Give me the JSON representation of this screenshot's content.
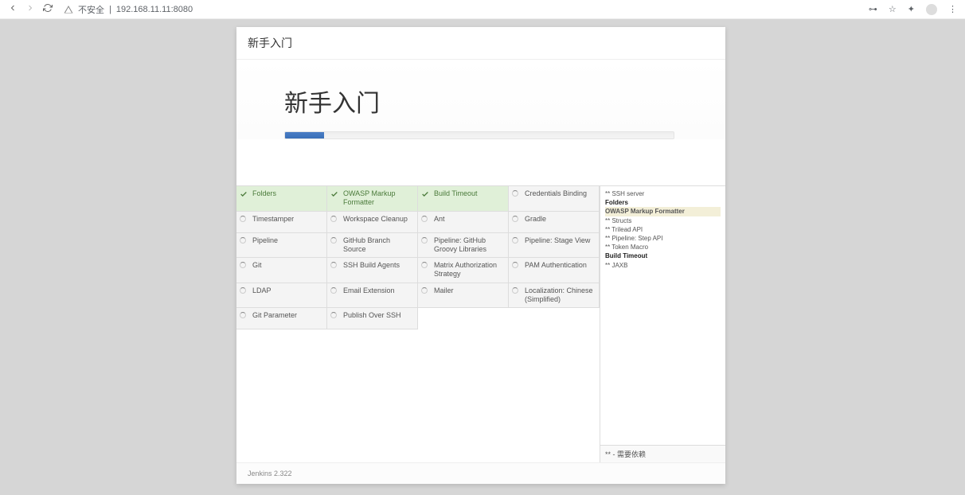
{
  "browser": {
    "insecure_label": "不安全",
    "url": "192.168.11.11:8080"
  },
  "dialog": {
    "header": "新手入门",
    "title": "新手入门",
    "progress_percent": 10,
    "footer_version": "Jenkins 2.322"
  },
  "plugins": [
    {
      "name": "Folders",
      "status": "done"
    },
    {
      "name": "OWASP Markup Formatter",
      "status": "done"
    },
    {
      "name": "Build Timeout",
      "status": "done"
    },
    {
      "name": "Credentials Binding",
      "status": "pending"
    },
    {
      "name": "Timestamper",
      "status": "pending"
    },
    {
      "name": "Workspace Cleanup",
      "status": "pending"
    },
    {
      "name": "Ant",
      "status": "pending"
    },
    {
      "name": "Gradle",
      "status": "pending"
    },
    {
      "name": "Pipeline",
      "status": "pending"
    },
    {
      "name": "GitHub Branch Source",
      "status": "pending"
    },
    {
      "name": "Pipeline: GitHub Groovy Libraries",
      "status": "pending"
    },
    {
      "name": "Pipeline: Stage View",
      "status": "pending"
    },
    {
      "name": "Git",
      "status": "pending"
    },
    {
      "name": "SSH Build Agents",
      "status": "pending"
    },
    {
      "name": "Matrix Authorization Strategy",
      "status": "pending"
    },
    {
      "name": "PAM Authentication",
      "status": "pending"
    },
    {
      "name": "LDAP",
      "status": "pending"
    },
    {
      "name": "Email Extension",
      "status": "pending"
    },
    {
      "name": "Mailer",
      "status": "pending"
    },
    {
      "name": "Localization: Chinese (Simplified)",
      "status": "pending"
    },
    {
      "name": "Git Parameter",
      "status": "pending"
    },
    {
      "name": "Publish Over SSH",
      "status": "pending"
    }
  ],
  "log": {
    "lines": [
      {
        "text": "** SSH server",
        "cls": ""
      },
      {
        "text": "Folders",
        "cls": "bold"
      },
      {
        "text": "OWASP Markup Formatter",
        "cls": "hl"
      },
      {
        "text": "** Structs",
        "cls": ""
      },
      {
        "text": "** Trilead API",
        "cls": ""
      },
      {
        "text": "** Pipeline: Step API",
        "cls": ""
      },
      {
        "text": "** Token Macro",
        "cls": ""
      },
      {
        "text": "Build Timeout",
        "cls": "bold"
      },
      {
        "text": "** JAXB",
        "cls": ""
      }
    ],
    "footer": "** - 需要依赖"
  }
}
